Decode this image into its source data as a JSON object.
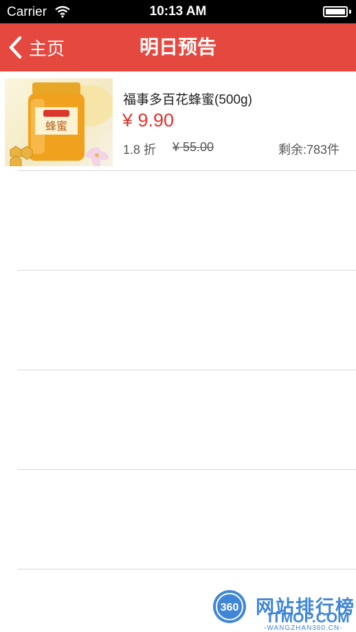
{
  "status_bar": {
    "carrier": "Carrier",
    "time": "10:13 AM",
    "wifi_icon": "wifi-icon",
    "battery_icon": "battery-icon"
  },
  "nav": {
    "back_label": "主页",
    "back_icon": "chevron-left-icon",
    "title": "明日预告",
    "background_color": "#e5483f"
  },
  "products": [
    {
      "name": "福事多百花蜂蜜(500g)",
      "price": "¥ 9.90",
      "discount": "1.8 折",
      "original_price": "¥ 55.00",
      "stock": "剩余:783件",
      "image_label": "蜂蜜"
    }
  ],
  "empty_rows": 4,
  "colors": {
    "accent": "#e5483f",
    "price": "#e3322b",
    "watermark": "#3f86d8"
  },
  "watermark": {
    "logo_text": "360",
    "title": "网站排行榜",
    "subtitle": "ITMOP.COM",
    "url": "-WANGZHAN360.CN-"
  }
}
